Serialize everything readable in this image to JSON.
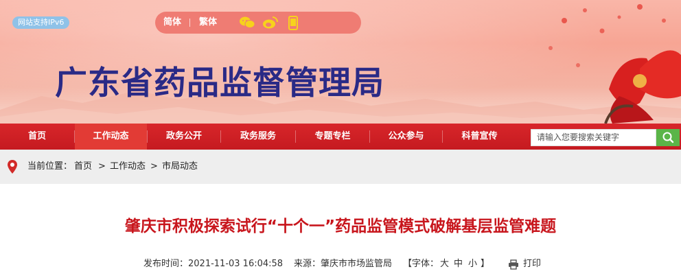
{
  "header": {
    "ipv6_badge": "网站支持IPv6",
    "lang_simplified": "简体",
    "lang_traditional": "繁体",
    "site_title": "广东省药品监督管理局"
  },
  "nav": {
    "items": [
      {
        "label": "首页"
      },
      {
        "label": "工作动态"
      },
      {
        "label": "政务公开"
      },
      {
        "label": "政务服务"
      },
      {
        "label": "专题专栏"
      },
      {
        "label": "公众参与"
      },
      {
        "label": "科普宣传"
      }
    ],
    "active_index": 1,
    "search_placeholder": "请输入您要搜索关键字"
  },
  "breadcrumb": {
    "prefix": "当前位置：",
    "items": [
      "首页",
      "工作动态",
      "市局动态"
    ],
    "separator": ">"
  },
  "article": {
    "title": "肇庆市积极探索试行“十个一”药品监管模式破解基层监管难题",
    "publish_label": "发布时间：",
    "publish_time": "2021-11-03 16:04:58",
    "source_label": "来源：",
    "source": "肇庆市市场监管局",
    "font_label_open": "【字体：",
    "font_large": "大",
    "font_medium": "中",
    "font_small": "小",
    "font_label_close": "】",
    "print_label": "打印"
  },
  "colors": {
    "nav_red": "#c51a20",
    "nav_active": "#e23b35",
    "title_blue": "#2a2a86",
    "article_red": "#c8161d",
    "search_green": "#5bb548"
  },
  "icons": [
    "wechat-icon",
    "weibo-icon",
    "mobile-icon",
    "location-pin-icon",
    "search-icon",
    "printer-icon"
  ]
}
